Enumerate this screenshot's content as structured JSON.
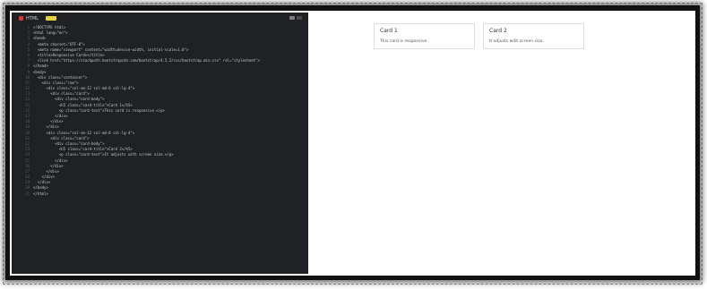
{
  "editor": {
    "tab_label": "HTML",
    "badge_label": "",
    "lines": [
      "<!DOCTYPE html>",
      "<html lang=\"en\">",
      "<head>",
      "  <meta charset=\"UTF-8\">",
      "  <meta name=\"viewport\" content=\"width=device-width, initial-scale=1.0\">",
      "  <title>Responsive Cards</title>",
      "  <link href=\"https://stackpath.bootstrapcdn.com/bootstrap/4.5.2/css/bootstrap.min.css\" rel=\"stylesheet\">",
      "</head>",
      "<body>",
      "  <div class=\"container\">",
      "    <div class=\"row\">",
      "      <div class=\"col-sm-12 col-md-6 col-lg-4\">",
      "        <div class=\"card\">",
      "          <div class=\"card-body\">",
      "            <h5 class=\"card-title\">Card 1</h5>",
      "            <p class=\"card-text\">This card is responsive.</p>",
      "          </div>",
      "        </div>",
      "      </div>",
      "      <div class=\"col-sm-12 col-md-6 col-lg-4\">",
      "        <div class=\"card\">",
      "          <div class=\"card-body\">",
      "            <h5 class=\"card-title\">Card 2</h5>",
      "            <p class=\"card-text\">It adjusts with screen size.</p>",
      "          </div>",
      "        </div>",
      "      </div>",
      "    </div>",
      "  </div>",
      "</body>",
      "</html>"
    ]
  },
  "preview": {
    "cards": [
      {
        "title": "Card 1",
        "text": "This card is responsive."
      },
      {
        "title": "Card 2",
        "text": "It adjusts with screen size."
      }
    ]
  }
}
